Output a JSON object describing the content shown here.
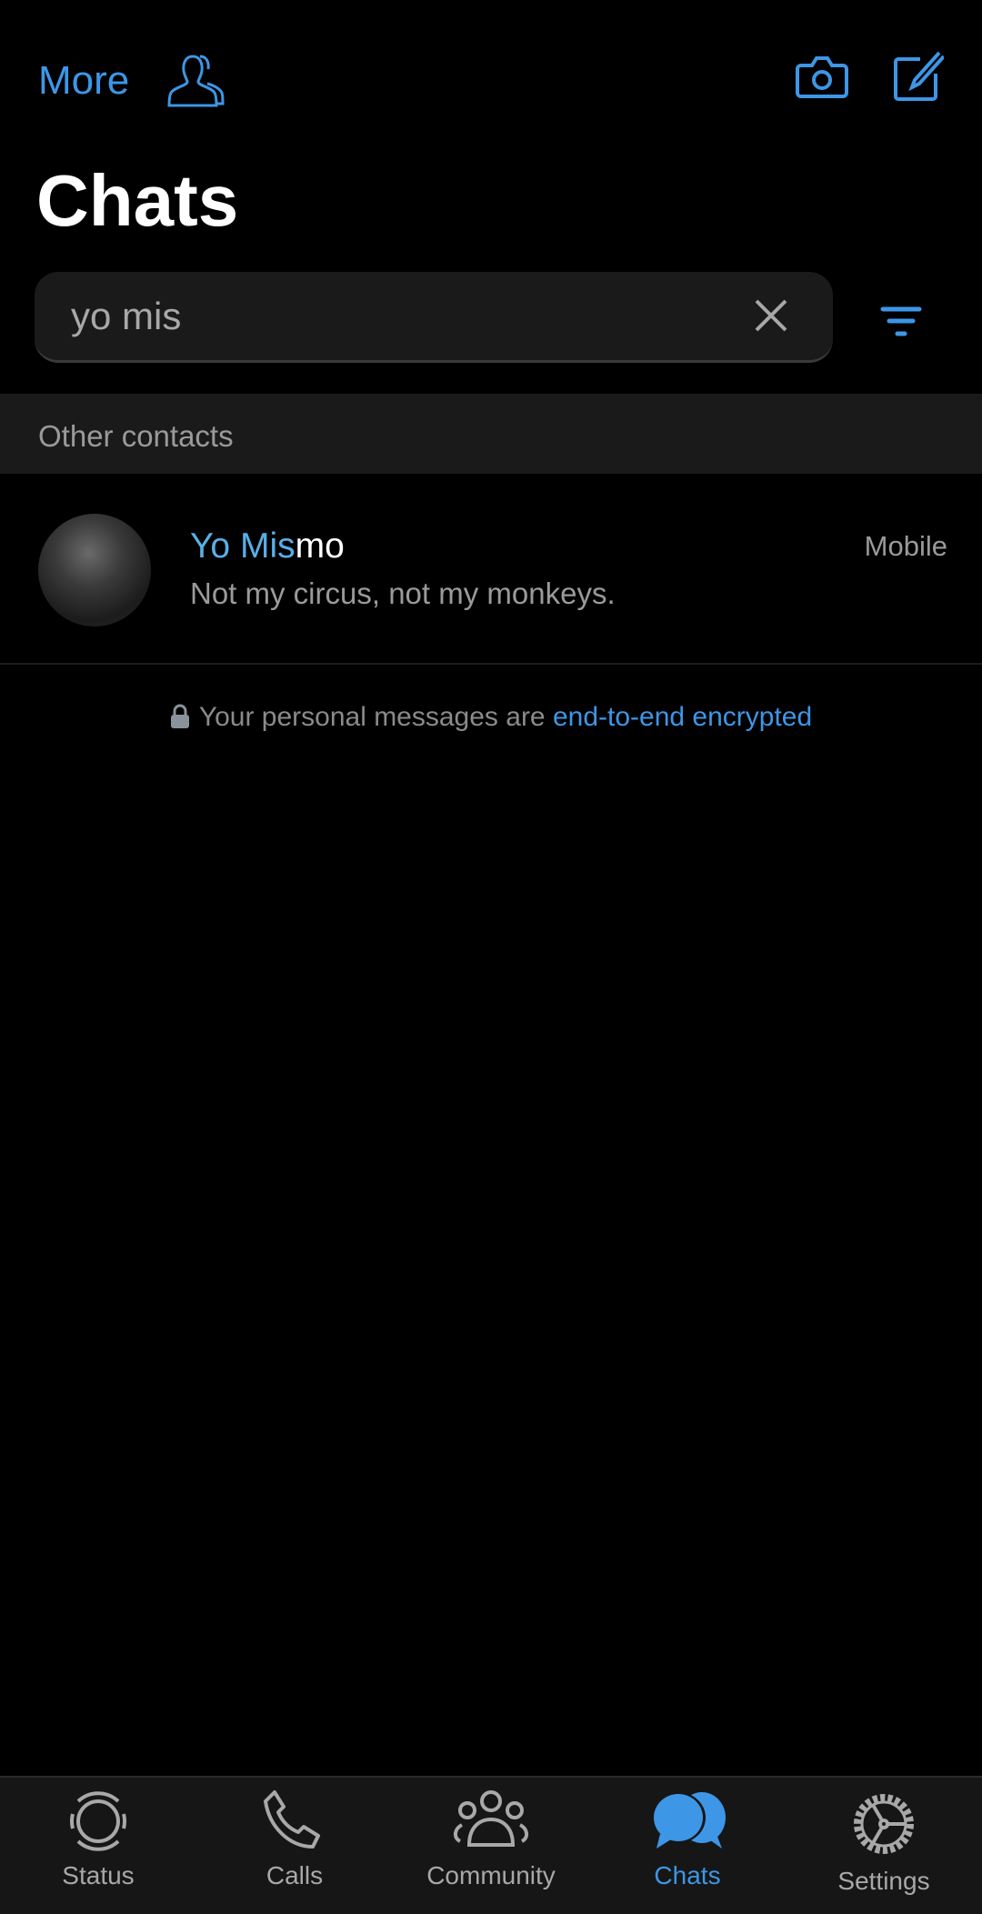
{
  "header": {
    "more_label": "More",
    "title": "Chats"
  },
  "search": {
    "value": "yo mis"
  },
  "section": {
    "label": "Other contacts"
  },
  "results": [
    {
      "name_highlight": "Yo Mis",
      "name_rest": "mo",
      "preview": "Not my circus, not my monkeys.",
      "label": "Mobile"
    }
  ],
  "encryption": {
    "text": "Your personal messages are ",
    "link": "end-to-end encrypted"
  },
  "tabs": [
    {
      "label": "Status",
      "icon": "status-icon"
    },
    {
      "label": "Calls",
      "icon": "phone-icon"
    },
    {
      "label": "Community",
      "icon": "community-icon"
    },
    {
      "label": "Chats",
      "icon": "chats-icon",
      "active": true
    },
    {
      "label": "Settings",
      "icon": "gear-icon"
    }
  ],
  "colors": {
    "accent": "#3d96e6",
    "highlight": "#5aaee6",
    "background": "#000000",
    "tabbar": "#161616"
  }
}
